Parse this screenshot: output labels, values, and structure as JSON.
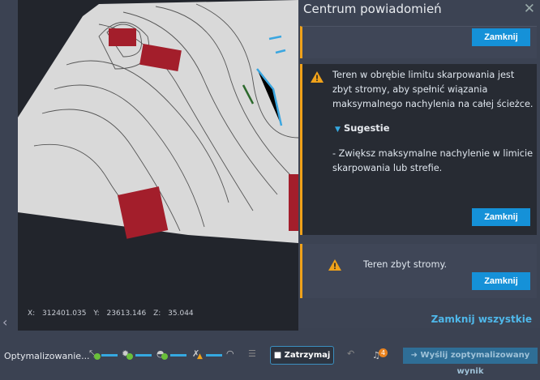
{
  "panel": {
    "title": "Centrum powiadomień",
    "close_all": "Zamknij wszystkie",
    "cards": [
      {
        "button": "Zamknij"
      },
      {
        "message": "Teren w obrębie limitu skarpowania jest zbyt stromy, aby spełnić wiązania maksymalnego nachylenia na całej ścieżce.",
        "suggestions_label": "Sugestie",
        "suggestion": "- Zwiększ maksymalne nachylenie w limicie skarpowania lub strefie.",
        "button": "Zamknij"
      },
      {
        "message": "Teren zbyt stromy.",
        "button": "Zamknij"
      }
    ]
  },
  "viewport": {
    "x": "X: 312401.035",
    "y": "Y: 23613.146",
    "z": "Z: 35.044"
  },
  "toolbar": {
    "status": "Optymalizowanie...",
    "stop": "Zatrzymaj",
    "notifications_count": "4",
    "send": "Wyślij zoptymalizowany wynik"
  },
  "colors": {
    "accent": "#1591d8",
    "warning": "#f0a21a",
    "link": "#4fb8ea"
  }
}
